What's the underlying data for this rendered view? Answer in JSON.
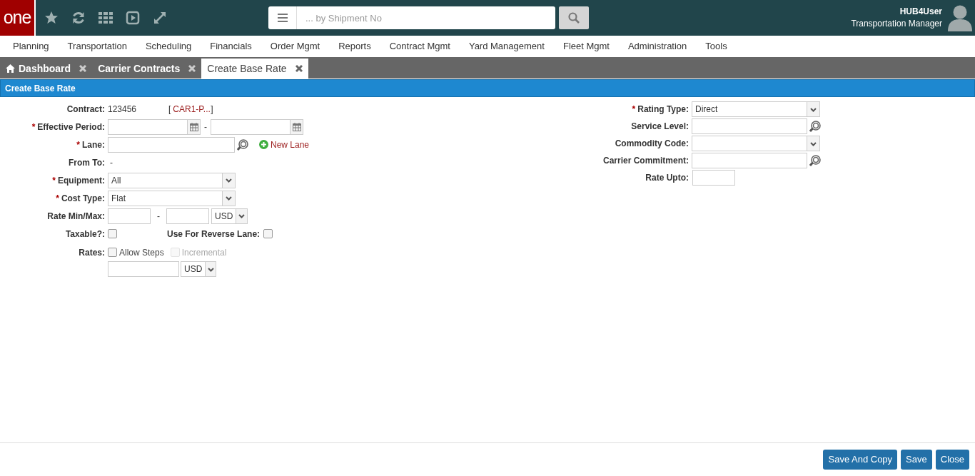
{
  "header": {
    "logo": "one",
    "search_placeholder": "... by Shipment No",
    "user_name": "HUB4User",
    "user_role": "Transportation Manager"
  },
  "menu": [
    "Planning",
    "Transportation",
    "Scheduling",
    "Financials",
    "Order Mgmt",
    "Reports",
    "Contract Mgmt",
    "Yard Management",
    "Fleet Mgmt",
    "Administration",
    "Tools"
  ],
  "tabs": [
    {
      "label": "Dashboard",
      "selected": false,
      "home": true
    },
    {
      "label": "Carrier Contracts",
      "selected": false,
      "home": false
    },
    {
      "label": "Create Base Rate",
      "selected": true,
      "home": false
    }
  ],
  "panel_title": "Create Base Rate",
  "left_fields": [
    {
      "kind": "contract",
      "label": "Contract:",
      "value": "123456",
      "link": "CAR1-P...",
      "bracket_open": "[",
      "bracket_close": "]"
    },
    {
      "kind": "date_range",
      "label": "Effective Period:",
      "mark": "*",
      "separator": "-"
    },
    {
      "kind": "lookup",
      "label": "Lane:",
      "mark": "*",
      "action": "New Lane"
    },
    {
      "kind": "text",
      "label": "From To:",
      "detail": "-"
    },
    {
      "kind": "select",
      "label": "Equipment:",
      "mark": "*",
      "value": "All"
    },
    {
      "kind": "select",
      "label": "Cost Type:",
      "mark": "*",
      "value": "Flat"
    },
    {
      "kind": "minmax",
      "label": "Rate Min/Max:",
      "separator": "-",
      "currency": "USD"
    },
    {
      "kind": "checks",
      "label": "Taxable?:",
      "checked": false,
      "extra_label": "Use For Reverse Lane:",
      "extra_checked": false
    },
    {
      "kind": "rates",
      "label": "Rates:",
      "options": [
        {
          "label": "Allow Steps",
          "checked": false,
          "disabled": false
        },
        {
          "label": "Incremental",
          "checked": false,
          "disabled": true
        }
      ],
      "currency": "USD"
    }
  ],
  "right_fields": [
    {
      "kind": "select",
      "label": "Rating Type:",
      "mark": "*",
      "value": "Direct"
    },
    {
      "kind": "lookup",
      "label": "Service Level:"
    },
    {
      "kind": "select",
      "label": "Commodity Code:"
    },
    {
      "kind": "lookup",
      "label": "Carrier Commitment:"
    },
    {
      "kind": "short",
      "label": "Rate Upto:"
    }
  ],
  "buttons": [
    "Save And Copy",
    "Save",
    "Close"
  ]
}
